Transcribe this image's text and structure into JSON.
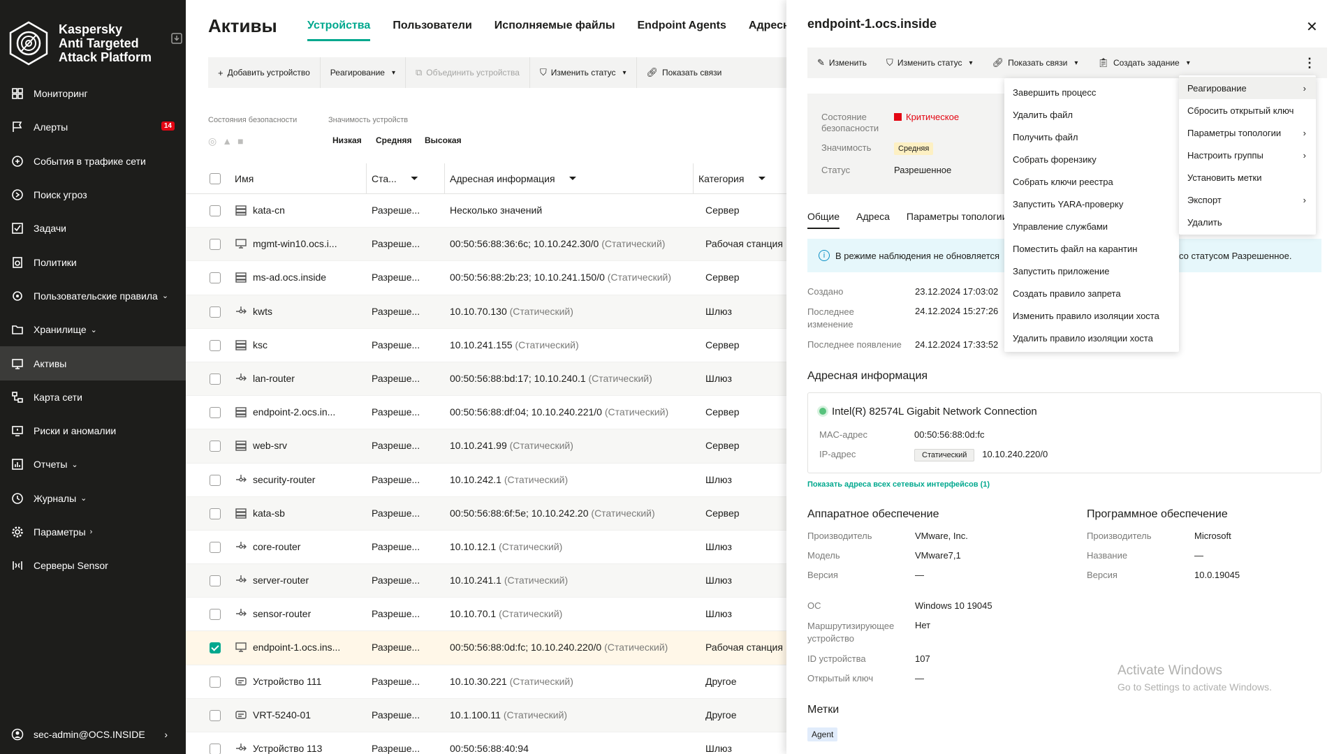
{
  "sidebar": {
    "brand": "Kaspersky Anti Targeted Attack Platform",
    "brand_lines": [
      "Kaspersky",
      "Anti Targeted",
      "Attack Platform"
    ],
    "items": [
      {
        "label": "Мониторинг",
        "icon": "dashboard-icon"
      },
      {
        "label": "Алерты",
        "icon": "flag-icon",
        "badge": "14"
      },
      {
        "label": "События в трафике сети",
        "icon": "traffic-icon"
      },
      {
        "label": "Поиск угроз",
        "icon": "threat-search-icon"
      },
      {
        "label": "Задачи",
        "icon": "tasks-icon"
      },
      {
        "label": "Политики",
        "icon": "policy-icon"
      },
      {
        "label": "Пользовательские правила",
        "icon": "rules-icon",
        "chevron": "⌄"
      },
      {
        "label": "Хранилище",
        "icon": "folder-icon",
        "chevron": "⌄"
      },
      {
        "label": "Активы",
        "icon": "monitor-icon",
        "active": true
      },
      {
        "label": "Карта сети",
        "icon": "network-map-icon"
      },
      {
        "label": "Риски и аномалии",
        "icon": "risk-icon"
      },
      {
        "label": "Отчеты",
        "icon": "report-icon",
        "chevron": "⌄"
      },
      {
        "label": "Журналы",
        "icon": "journal-icon",
        "chevron": "⌄"
      },
      {
        "label": "Параметры",
        "icon": "gear-icon",
        "chevron": "›"
      },
      {
        "label": "Серверы Sensor",
        "icon": "sensor-icon"
      }
    ],
    "user": "sec-admin@OCS.INSIDE"
  },
  "main": {
    "title": "Активы",
    "tabs": [
      "Устройства",
      "Пользователи",
      "Исполняемые файлы",
      "Endpoint Agents",
      "Адресны"
    ],
    "toolbar": {
      "add": "Добавить устройство",
      "respond": "Реагирование",
      "merge": "Объединить устройства",
      "change_status": "Изменить статус",
      "show_links": "Показать связи"
    },
    "filters": {
      "security_state": "Состояния безопасности",
      "importance": "Значимость устройств",
      "low": "Низкая",
      "medium": "Средняя",
      "high": "Высокая"
    },
    "columns": {
      "name": "Имя",
      "status": "Ста...",
      "address": "Адресная информация",
      "category": "Категория"
    },
    "rows": [
      {
        "name": "kata-cn",
        "status": "Разреше...",
        "address": "Несколько значений",
        "addr_note": "",
        "category": "Сервер",
        "icon": "server-icon"
      },
      {
        "name": "mgmt-win10.ocs.i...",
        "status": "Разреше...",
        "address": "00:50:56:88:36:6c; 10.10.242.30/0",
        "addr_note": "(Статический)",
        "category": "Рабочая станция",
        "icon": "workstation-icon"
      },
      {
        "name": "ms-ad.ocs.inside",
        "status": "Разреше...",
        "address": "00:50:56:88:2b:23; 10.10.241.150/0",
        "addr_note": "(Статический)",
        "category": "Сервер",
        "icon": "server-icon"
      },
      {
        "name": "kwts",
        "status": "Разреше...",
        "address": "10.10.70.130",
        "addr_note": "(Статический)",
        "category": "Шлюз",
        "icon": "gateway-icon"
      },
      {
        "name": "ksc",
        "status": "Разреше...",
        "address": "10.10.241.155",
        "addr_note": "(Статический)",
        "category": "Сервер",
        "icon": "server-icon"
      },
      {
        "name": "lan-router",
        "status": "Разреше...",
        "address": "00:50:56:88:bd:17; 10.10.240.1",
        "addr_note": "(Статический)",
        "category": "Шлюз",
        "icon": "gateway-icon"
      },
      {
        "name": "endpoint-2.ocs.in...",
        "status": "Разреше...",
        "address": "00:50:56:88:df:04; 10.10.240.221/0",
        "addr_note": "(Статический)",
        "category": "Сервер",
        "icon": "server-icon"
      },
      {
        "name": "web-srv",
        "status": "Разреше...",
        "address": "10.10.241.99",
        "addr_note": "(Статический)",
        "category": "Сервер",
        "icon": "server-icon"
      },
      {
        "name": "security-router",
        "status": "Разреше...",
        "address": "10.10.242.1",
        "addr_note": "(Статический)",
        "category": "Шлюз",
        "icon": "gateway-icon"
      },
      {
        "name": "kata-sb",
        "status": "Разреше...",
        "address": "00:50:56:88:6f:5e; 10.10.242.20",
        "addr_note": "(Статический)",
        "category": "Сервер",
        "icon": "server-icon"
      },
      {
        "name": "core-router",
        "status": "Разреше...",
        "address": "10.10.12.1",
        "addr_note": "(Статический)",
        "category": "Шлюз",
        "icon": "gateway-icon"
      },
      {
        "name": "server-router",
        "status": "Разреше...",
        "address": "10.10.241.1",
        "addr_note": "(Статический)",
        "category": "Шлюз",
        "icon": "gateway-icon"
      },
      {
        "name": "sensor-router",
        "status": "Разреше...",
        "address": "10.10.70.1",
        "addr_note": "(Статический)",
        "category": "Шлюз",
        "icon": "gateway-icon"
      },
      {
        "name": "endpoint-1.ocs.ins...",
        "status": "Разреше...",
        "address": "00:50:56:88:0d:fc; 10.10.240.220/0",
        "addr_note": "(Статический)",
        "category": "Рабочая станция",
        "icon": "workstation-icon",
        "selected": true
      },
      {
        "name": "Устройство 111",
        "status": "Разреше...",
        "address": "10.10.30.221",
        "addr_note": "(Статический)",
        "category": "Другое",
        "icon": "other-device-icon"
      },
      {
        "name": "VRT-5240-01",
        "status": "Разреше...",
        "address": "10.1.100.11",
        "addr_note": "(Статический)",
        "category": "Другое",
        "icon": "other-device-icon"
      },
      {
        "name": "Устройство 113",
        "status": "Разреше...",
        "address": "00:50:56:88:40:94",
        "addr_note": "",
        "category": "Шлюз",
        "icon": "gateway-icon"
      }
    ]
  },
  "panel": {
    "title": "endpoint-1.ocs.inside",
    "toolbar": {
      "edit": "Изменить",
      "change_status": "Изменить статус",
      "show_links": "Показать связи",
      "create_task": "Создать задание"
    },
    "security_state_label": "Состояние безопасности",
    "security_state_label_lines": [
      "Состояние",
      "безопасности"
    ],
    "security_state_value": "Критическое",
    "importance_label": "Значимость",
    "importance_value": "Средняя",
    "status_label": "Статус",
    "status_value": "Разрешенное",
    "tabs": [
      "Общие",
      "Адреса",
      "Параметры топологии"
    ],
    "banner_left": "В режиме наблюдения не обновляется",
    "banner_right": "со статусом Разрешенное.",
    "created_label": "Создано",
    "created_value": "23.12.2024 17:03:02",
    "modified_label_lines": [
      "Последнее",
      "изменение"
    ],
    "modified_value": "24.12.2024 15:27:26",
    "last_seen_label": "Последнее появление",
    "last_seen_value": "24.12.2024 17:33:52",
    "address_section": "Адресная информация",
    "nic_name": "Intel(R) 82574L Gigabit Network Connection",
    "mac_label": "MAC-адрес",
    "mac_value": "00:50:56:88:0d:fc",
    "ip_label": "IP-адрес",
    "ip_tag": "Статический",
    "ip_value": "10.10.240.220/0",
    "show_all_link": "Показать адреса всех сетевых интерфейсов (1)",
    "hw_title": "Аппаратное обеспечение",
    "hw_vendor_label": "Производитель",
    "hw_vendor": "VMware, Inc.",
    "hw_model_label": "Модель",
    "hw_model": "VMware7,1",
    "hw_version_label": "Версия",
    "hw_version": "—",
    "sw_title": "Программное обеспечение",
    "sw_vendor_label": "Производитель",
    "sw_vendor": "Microsoft",
    "sw_name_label": "Название",
    "sw_name": "—",
    "sw_version_label": "Версия",
    "sw_version": "10.0.19045",
    "os_label": "ОС",
    "os_value": "Windows 10 19045",
    "routing_label_lines": [
      "Маршрутизирующее",
      "устройство"
    ],
    "routing_value": "Нет",
    "device_id_label": "ID устройства",
    "device_id_value": "107",
    "pubkey_label": "Открытый ключ",
    "pubkey_value": "—",
    "tags_title": "Метки",
    "tag": "Agent"
  },
  "respond_menu": {
    "items": [
      "Завершить процесс",
      "Удалить файл",
      "Получить файл",
      "Собрать форензику",
      "Собрать ключи реестра",
      "Запустить YARA-проверку",
      "Управление службами",
      "Поместить файл на карантин",
      "Запустить приложение",
      "Создать правило запрета",
      "Изменить правило изоляции хоста",
      "Удалить правило изоляции хоста"
    ]
  },
  "more_menu": {
    "items": [
      {
        "label": "Реагирование",
        "sub": "›"
      },
      {
        "label": "Сбросить открытый ключ",
        "sub": ""
      },
      {
        "label": "Параметры топологии",
        "sub": "›"
      },
      {
        "label": "Настроить группы",
        "sub": "›"
      },
      {
        "label": "Установить метки",
        "sub": ""
      },
      {
        "label": "Экспорт",
        "sub": "›"
      },
      {
        "label": "Удалить",
        "sub": ""
      }
    ]
  },
  "watermark": {
    "line1": "Activate Windows",
    "line2": "Go to Settings to activate Windows."
  },
  "colors": {
    "accent": "#00a88e",
    "critical": "#e30613",
    "sidebar_bg": "#1d1d1b"
  }
}
